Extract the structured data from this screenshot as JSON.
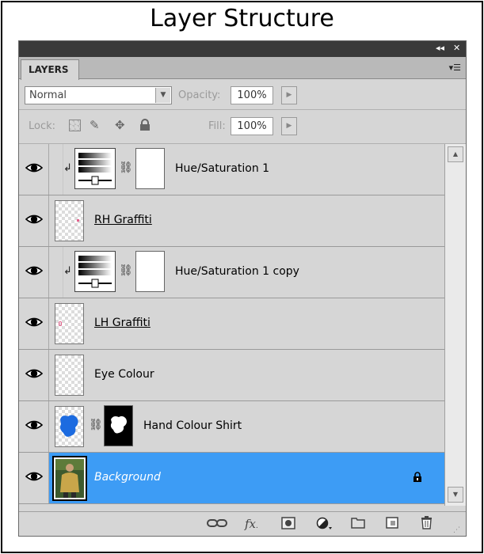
{
  "caption": "Layer Structure",
  "panel": {
    "tab_label": "LAYERS",
    "collapse_glyph": "◂◂",
    "close_glyph": "✕",
    "menu_glyph": "▾☰",
    "blend_mode": "Normal",
    "opacity_label": "Opacity:",
    "opacity_value": "100%",
    "lock_label": "Lock:",
    "fill_label": "Fill:",
    "fill_value": "100%"
  },
  "layers": [
    {
      "name": "Hue/Saturation 1",
      "type": "adjustment",
      "clipped": true,
      "visible": true
    },
    {
      "name": "RH Graffiti",
      "type": "pixel",
      "underlined": true,
      "visible": true
    },
    {
      "name": "Hue/Saturation 1 copy",
      "type": "adjustment",
      "clipped": true,
      "visible": true
    },
    {
      "name": "LH Graffiti",
      "type": "pixel",
      "underlined": true,
      "visible": true
    },
    {
      "name": "Eye Colour",
      "type": "pixel",
      "visible": true
    },
    {
      "name": "Hand Colour Shirt",
      "type": "masked",
      "visible": true
    },
    {
      "name": "Background",
      "type": "background",
      "selected": true,
      "locked": true,
      "visible": true
    }
  ],
  "footer_icons": [
    "link-layers-icon",
    "fx-icon",
    "add-mask-icon",
    "adjustment-layer-icon",
    "new-group-icon",
    "new-layer-icon",
    "delete-layer-icon"
  ],
  "colors": {
    "selected_row": "#3d9cf5",
    "panel_bg": "#d6d6d6",
    "titlebar": "#3a3a3a"
  }
}
